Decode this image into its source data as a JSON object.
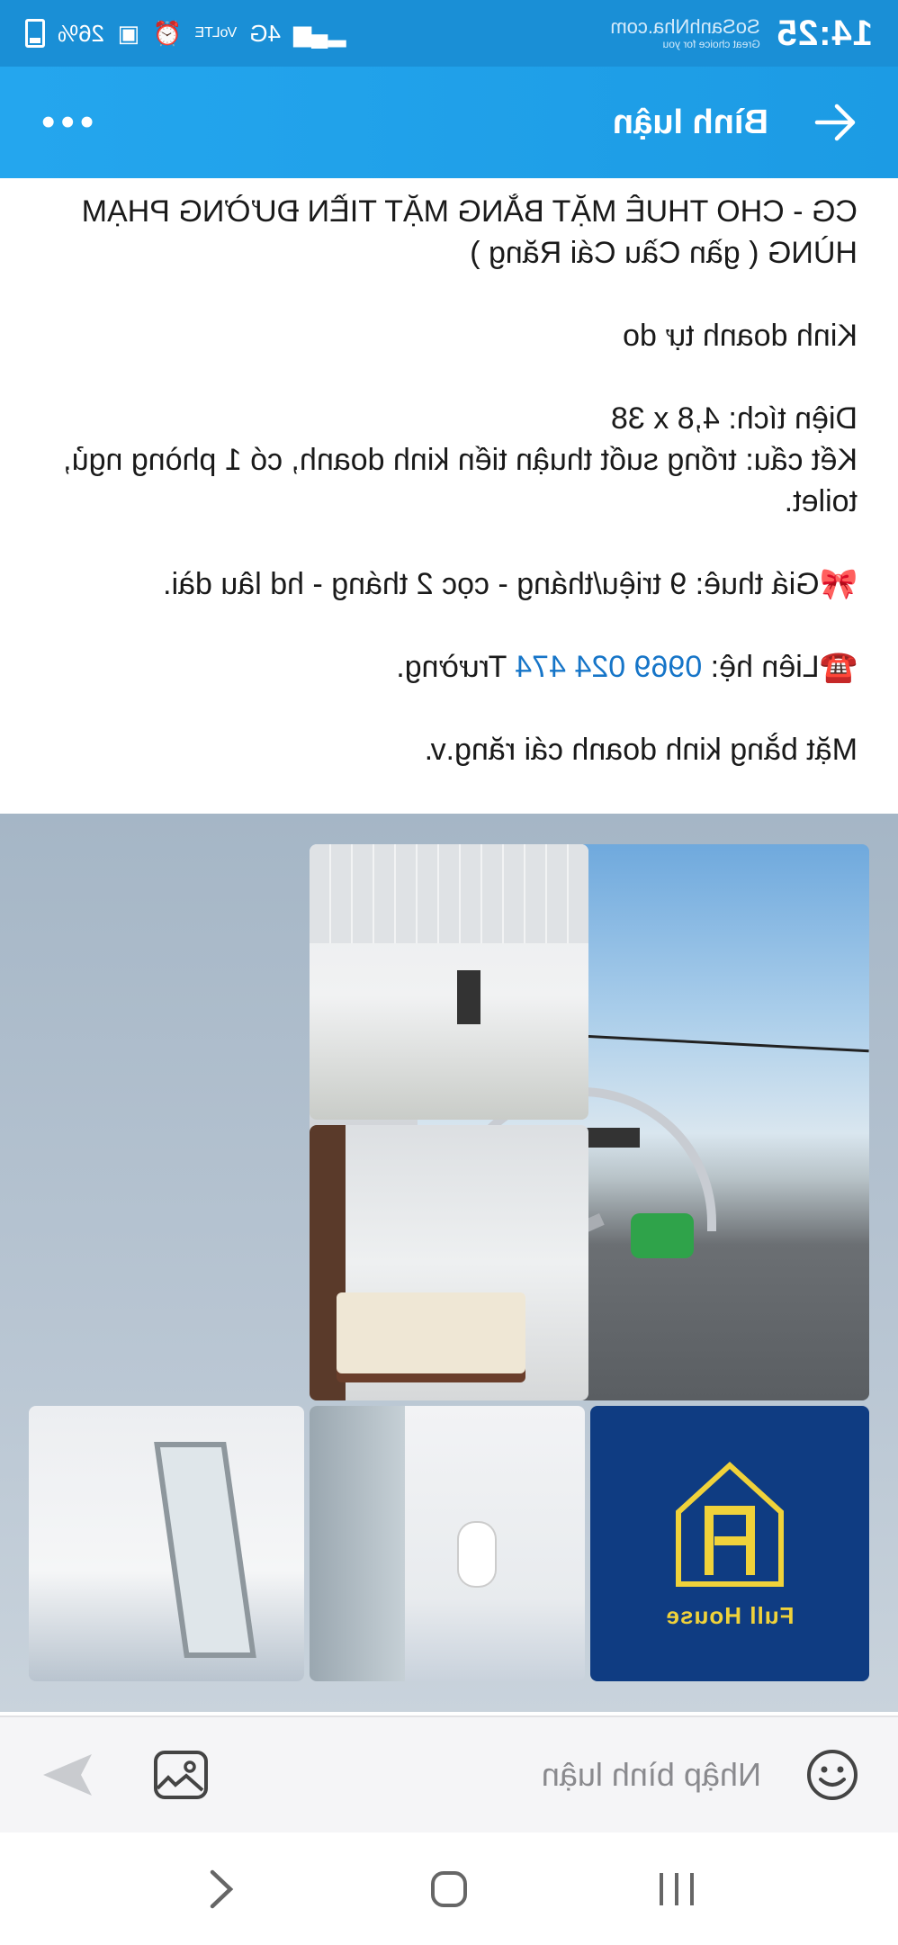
{
  "status_bar": {
    "time": "14:25",
    "battery": "26%",
    "network": "4G",
    "volte": "VoLTE",
    "watermark": "SoSanhNha.com",
    "watermark_sub": "Great choice for you"
  },
  "header": {
    "title": "Bình luận",
    "more_label": "•••"
  },
  "post": {
    "paragraphs": [
      "CG - CHO THUÊ MẶT BẰNG MẶT TIỀN ĐƯỜNG PHẠM HÙNG ( gần Cầu Cái Răng )",
      "Kinh doanh tự do",
      "Diện tích: 4,8 x 38\nKết cấu: trống suốt thuận tiến kinh doanh, có 1 phòng ngủ, toilet.",
      "🎀Giá thuê: 9 triệu/tháng - cọc 2 tháng - hd lâu dài.",
      "Mặt bằng kinh doanh cái răng.v."
    ],
    "contact_prefix": "☎️Liên hệ: ",
    "contact_phone": "0969 024 474",
    "contact_suffix": " Trường."
  },
  "photos": {
    "logo_text": "Full House"
  },
  "comment": {
    "placeholder": "Nhập bình luận"
  },
  "colors": {
    "header": "#1c9be4",
    "link": "#1675c8",
    "logo_bg": "#0f3c82",
    "logo_fg": "#f0d23a"
  },
  "icons": [
    "back-arrow-icon",
    "more-icon",
    "emoji-icon",
    "image-icon",
    "send-icon",
    "nav-back-icon",
    "nav-home-icon",
    "nav-recents-icon"
  ]
}
